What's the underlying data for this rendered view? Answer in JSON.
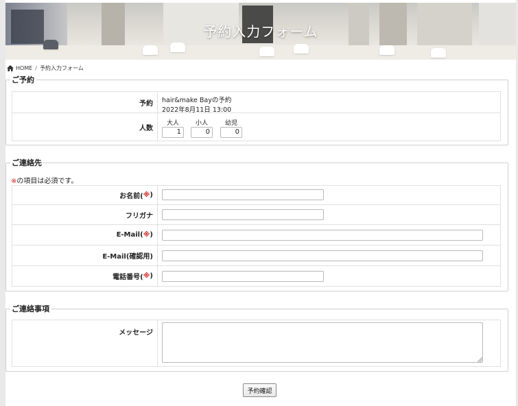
{
  "header": {
    "title": "予約入力フォーム"
  },
  "breadcrumb": {
    "home": "HOME",
    "separator": "/",
    "current": "予約入力フォーム"
  },
  "reservation": {
    "legend": "ご予約",
    "booking_label": "予約",
    "booking_line1": "hair&make Bayの予約",
    "booking_line2": "2022年8月11日 13:00",
    "people_label": "人数",
    "adult_label": "大人",
    "adult_value": "1",
    "child_label": "小人",
    "child_value": "0",
    "infant_label": "幼児",
    "infant_value": "0"
  },
  "contact": {
    "legend": "ご連絡先",
    "required_mark": "※",
    "required_note": "の項目は必須です。",
    "name_label": "お名前(",
    "name_mark": "※",
    "name_close": ")",
    "kana_label": "フリガナ",
    "email_label": "E-Mail(",
    "email_mark": "※",
    "email_close": ")",
    "email_confirm_label": "E-Mail(確認用)",
    "phone_label": "電話番号(",
    "phone_mark": "※",
    "phone_close": ")",
    "name_value": "",
    "kana_value": "",
    "email_value": "",
    "email_confirm_value": "",
    "phone_value": ""
  },
  "notes": {
    "legend": "ご連絡事項",
    "message_label": "メッセージ",
    "message_value": ""
  },
  "confirm_button": "予約確認",
  "colors": {
    "required": "#d02020",
    "border": "#cfcfcf"
  }
}
